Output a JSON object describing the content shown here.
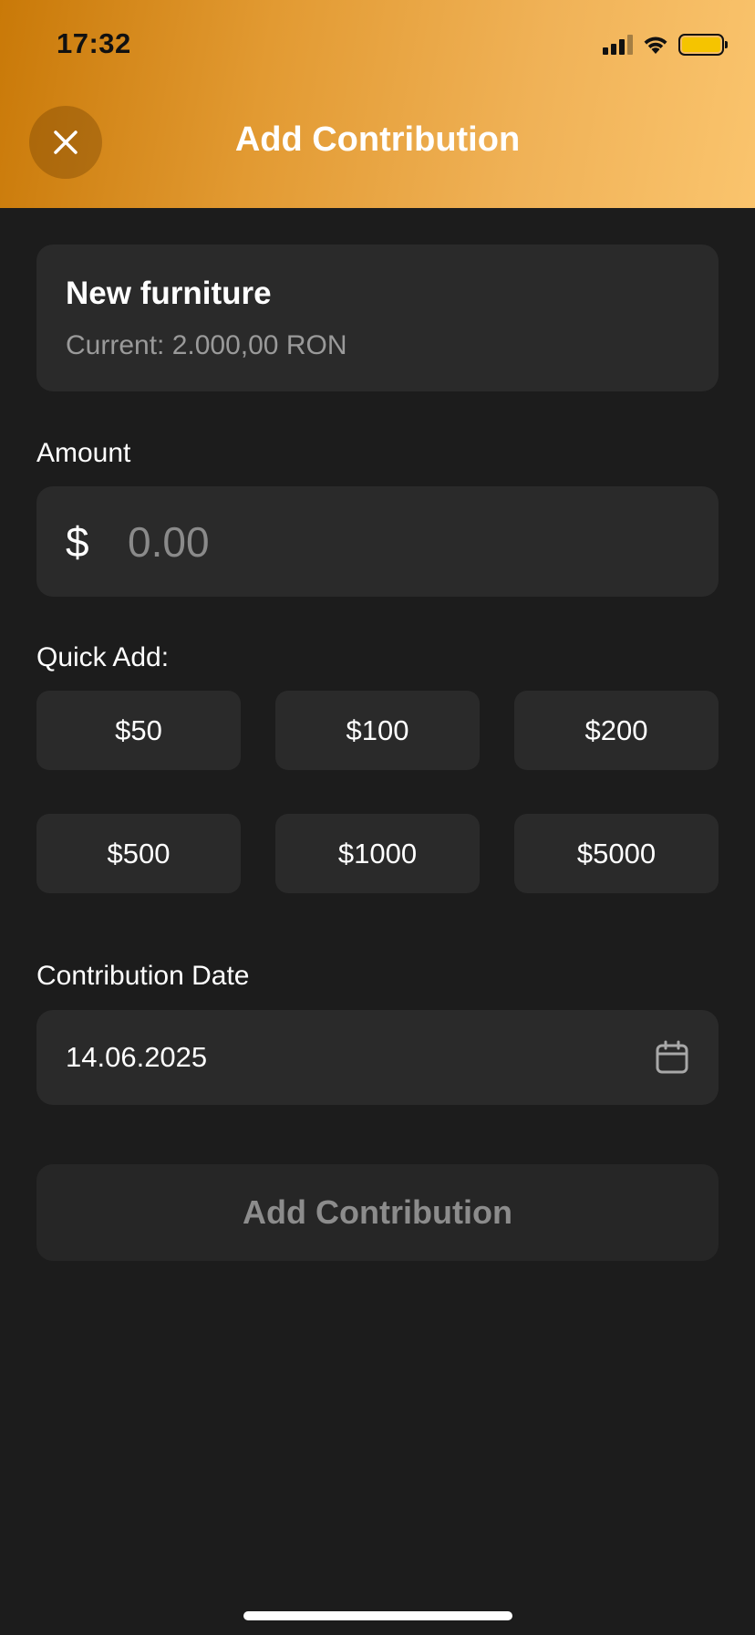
{
  "status_bar": {
    "time": "17:32",
    "icons": [
      "cellular-signal-icon",
      "wifi-icon",
      "battery-icon"
    ]
  },
  "header": {
    "title": "Add Contribution",
    "close_icon": "close-icon",
    "gradient_colors": [
      "#c97908",
      "#fac46d"
    ]
  },
  "goal": {
    "name": "New furniture",
    "current": "Current: 2.000,00 RON"
  },
  "amount": {
    "label": "Amount",
    "currency_symbol": "$",
    "placeholder": "0.00"
  },
  "quick_add": {
    "label": "Quick Add:",
    "options": [
      "$50",
      "$100",
      "$200",
      "$500",
      "$1000",
      "$5000"
    ]
  },
  "date": {
    "label": "Contribution Date",
    "value": "14.06.2025",
    "icon": "calendar-icon"
  },
  "submit": {
    "label": "Add Contribution"
  },
  "colors": {
    "background": "#1c1c1c",
    "surface": "#2a2a2a",
    "muted_text": "#9a9a9a"
  }
}
